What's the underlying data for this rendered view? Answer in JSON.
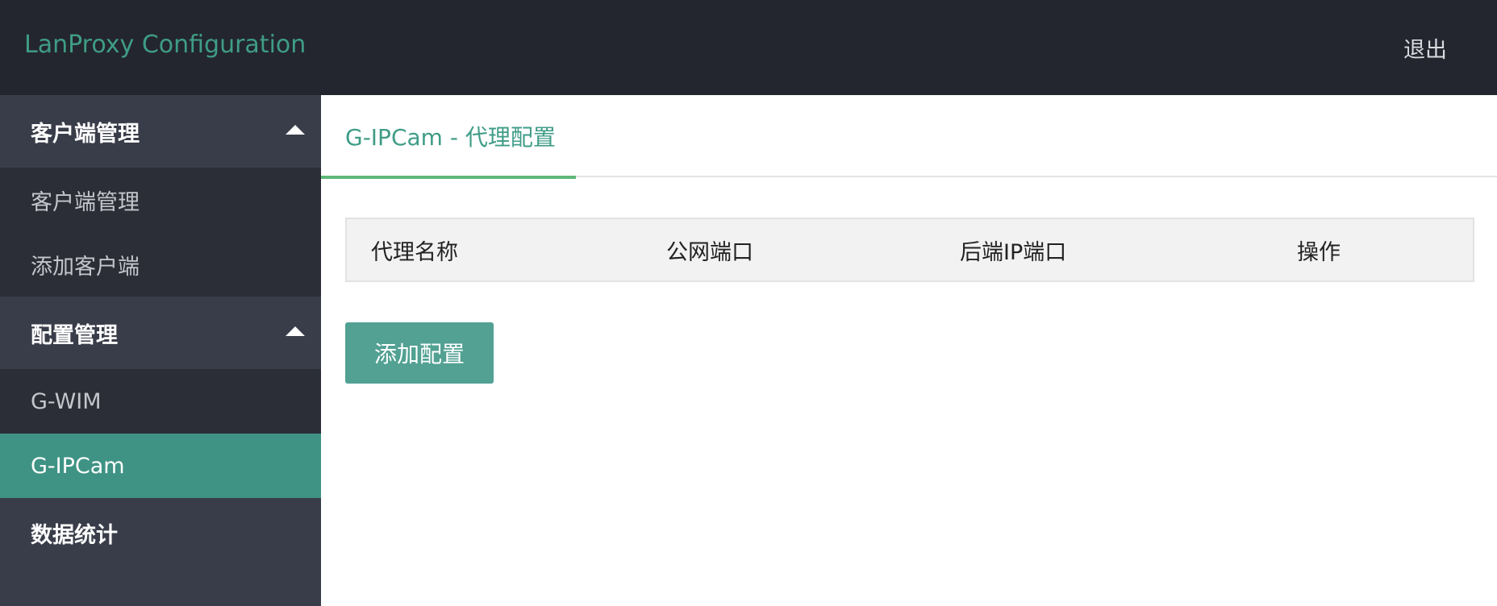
{
  "header": {
    "title": "LanProxy Configuration",
    "logout_label": "退出"
  },
  "sidebar": {
    "groups": [
      {
        "label": "客户端管理",
        "expanded": true,
        "items": [
          {
            "label": "客户端管理",
            "active": false
          },
          {
            "label": "添加客户端",
            "active": false
          }
        ]
      },
      {
        "label": "配置管理",
        "expanded": true,
        "items": [
          {
            "label": "G-WIM",
            "active": false
          },
          {
            "label": "G-IPCam",
            "active": true
          }
        ]
      }
    ],
    "standalone": {
      "label": "数据统计"
    }
  },
  "main": {
    "tab_label": "G-IPCam - 代理配置",
    "table": {
      "columns": [
        "代理名称",
        "公网端口",
        "后端IP端口",
        "操作"
      ],
      "rows": []
    },
    "add_button_label": "添加配置"
  },
  "colors": {
    "header_bg": "#23262e",
    "sidebar_bg": "#393d49",
    "sidebar_sub_bg": "#2b2e37",
    "active_item_bg": "#3f9384",
    "accent_text": "#3f9c87",
    "tab_underline": "#5fb878",
    "button_bg": "#52a193"
  }
}
